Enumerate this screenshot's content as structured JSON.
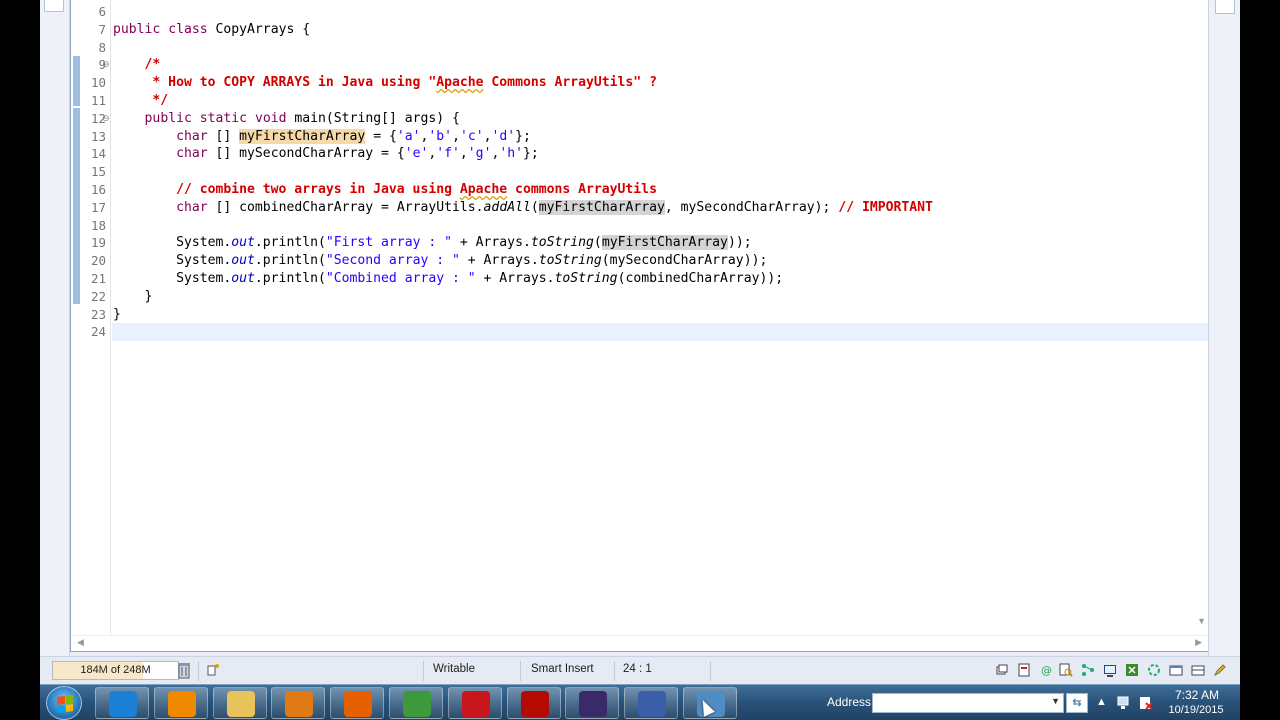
{
  "editor": {
    "lines": [
      {
        "n": "6",
        "html": ""
      },
      {
        "n": "7",
        "html": "<span class=\"kw\">public</span> <span class=\"kw\">class</span> CopyArrays {"
      },
      {
        "n": "8",
        "html": ""
      },
      {
        "n": "9",
        "fold": true,
        "html": "    <span class=\"cm\">/*</span>"
      },
      {
        "n": "10",
        "html": "<span class=\"cm\">     * How to COPY ARRAYS in Java using \"<span class=\"spell\">Apache</span> Commons ArrayUtils\" ?</span>"
      },
      {
        "n": "11",
        "html": "<span class=\"cm\">     */</span>"
      },
      {
        "n": "12",
        "fold": true,
        "html": "    <span class=\"kw\">public</span> <span class=\"kw\">static</span> <span class=\"kw\">void</span> main(String[] args) {"
      },
      {
        "n": "13",
        "html": "        <span class=\"kw\">char</span> [] <span class=\"occw\">myFirstCharArray</span> = {<span class=\"str\">'a'</span>,<span class=\"str\">'b'</span>,<span class=\"str\">'c'</span>,<span class=\"str\">'d'</span>};"
      },
      {
        "n": "14",
        "html": "        <span class=\"kw\">char</span> [] mySecondCharArray = {<span class=\"str\">'e'</span>,<span class=\"str\">'f'</span>,<span class=\"str\">'g'</span>,<span class=\"str\">'h'</span>};"
      },
      {
        "n": "15",
        "html": ""
      },
      {
        "n": "16",
        "html": "<span class=\"cm\">        // combine two arrays in Java using <span class=\"spell\">Apache</span> commons ArrayUtils</span>"
      },
      {
        "n": "17",
        "html": "        <span class=\"kw\">char</span> [] combinedCharArray = ArrayUtils.<span class=\"it\">addAll</span>(<span class=\"occ\">myFirstCharArray</span>, mySecondCharArray); <span class=\"cm\">// IMPORTANT</span>"
      },
      {
        "n": "18",
        "html": ""
      },
      {
        "n": "19",
        "html": "        System.<span class=\"field\">out</span>.println(<span class=\"str\">\"First array : \"</span> + Arrays.<span class=\"it\">toString</span>(<span class=\"occ\">myFirstCharArray</span>));"
      },
      {
        "n": "20",
        "html": "        System.<span class=\"field\">out</span>.println(<span class=\"str\">\"Second array : \"</span> + Arrays.<span class=\"it\">toString</span>(mySecondCharArray));"
      },
      {
        "n": "21",
        "html": "        System.<span class=\"field\">out</span>.println(<span class=\"str\">\"Combined array : \"</span> + Arrays.<span class=\"it\">toString</span>(combinedCharArray));"
      },
      {
        "n": "22",
        "html": "    }"
      },
      {
        "n": "23",
        "html": "}"
      },
      {
        "n": "24",
        "html": "",
        "current": true
      }
    ]
  },
  "status": {
    "heap": "184M of 248M",
    "mode": "Writable",
    "insert": "Smart Insert",
    "position": "24 : 1"
  },
  "taskbar": {
    "address_label": "Address",
    "address_value": "",
    "time": "7:32 AM",
    "date": "10/19/2015",
    "apps": [
      {
        "name": "internet-explorer",
        "color": "#1c7fd6"
      },
      {
        "name": "vlc",
        "color": "#f08a00"
      },
      {
        "name": "file-explorer",
        "color": "#e8c25a"
      },
      {
        "name": "media-player",
        "color": "#e07a16"
      },
      {
        "name": "firefox",
        "color": "#e66000"
      },
      {
        "name": "chrome",
        "color": "#3c9a3c"
      },
      {
        "name": "red-app",
        "color": "#c8161d"
      },
      {
        "name": "acrobat",
        "color": "#b30b00"
      },
      {
        "name": "java-ee-ide",
        "color": "#3a2a6a"
      },
      {
        "name": "save-app",
        "color": "#3a5fa8"
      },
      {
        "name": "remote-desktop",
        "color": "#4e8cc2"
      }
    ]
  }
}
